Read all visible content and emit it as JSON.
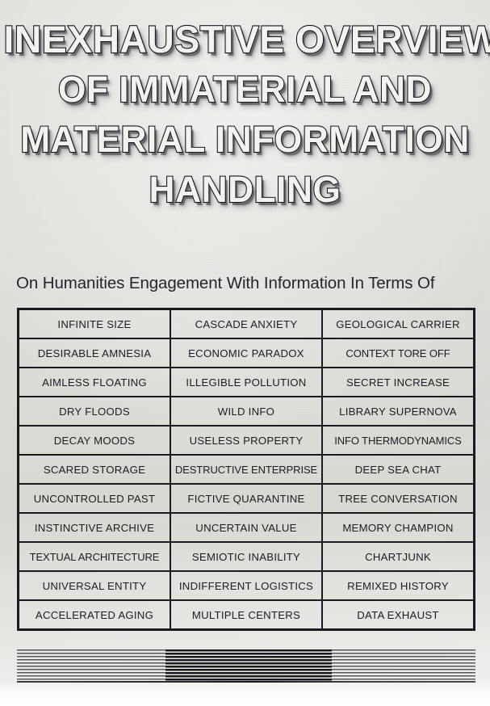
{
  "poster": {
    "background_color": "#dbdbd6",
    "headline": {
      "lines": [
        "INEXHAUSTIVE OVERVIEW",
        "OF IMMATERIAL AND",
        "MATERIAL INFORMATION",
        "HANDLING"
      ],
      "fill_color": "#f2f2ee",
      "outline_color": "#15151a"
    },
    "subtitle": "On Humanities Engagement With Information In Terms Of",
    "table": {
      "border_color": "#1b1b1f",
      "columns": 3,
      "rows": [
        [
          "INFINITE SIZE",
          "CASCADE ANXIETY",
          "GEOLOGICAL CARRIER"
        ],
        [
          "DESIRABLE AMNESIA",
          "ECONOMIC PARADOX",
          "CONTEXT TORE OFF"
        ],
        [
          "AIMLESS FLOATING",
          "ILLEGIBLE POLLUTION",
          "SECRET INCREASE"
        ],
        [
          "DRY FLOODS",
          "WILD INFO",
          "LIBRARY SUPERNOVA"
        ],
        [
          "DECAY MOODS",
          "USELESS PROPERTY",
          "INFO THERMODYNAMICS"
        ],
        [
          "SCARED STORAGE",
          "DESTRUCTIVE ENTERPRISE",
          "DEEP SEA CHAT"
        ],
        [
          "UNCONTROLLED PAST",
          "FICTIVE QUARANTINE",
          "TREE CONVERSATION"
        ],
        [
          "INSTINCTIVE ARCHIVE",
          "UNCERTAIN VALUE",
          "MEMORY CHAMPION"
        ],
        [
          "TEXTUAL ARCHITECTURE",
          "SEMIOTIC INABILITY",
          "CHARTJUNK"
        ],
        [
          "UNIVERSAL ENTITY",
          "INDIFFERENT LOGISTICS",
          "REMIXED HISTORY"
        ],
        [
          "ACCELERATED AGING",
          "MULTIPLE CENTERS",
          "DATA EXHAUST"
        ]
      ]
    },
    "footer_stripes": {
      "segments": [
        {
          "name": "left-light-stripes",
          "shade": "#55555a"
        },
        {
          "name": "center-dark-stripes",
          "shade": "#1a1a1e"
        },
        {
          "name": "right-light-stripes",
          "shade": "#55555a"
        }
      ]
    }
  }
}
